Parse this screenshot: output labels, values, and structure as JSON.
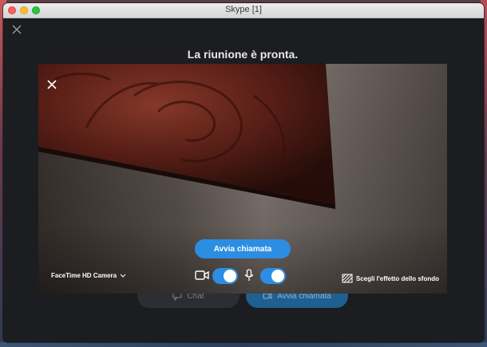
{
  "window": {
    "title": "Skype [1]"
  },
  "main": {
    "heading": "La riunione è pronta.",
    "chat_button": "Chat",
    "start_call_button": "Avvia chiamata"
  },
  "preview": {
    "start_call_label": "Avvia chiamata",
    "camera_name": "FaceTime HD Camera",
    "background_effect": "Scegli l'effetto dello sfondo",
    "video_enabled": true,
    "mic_enabled": true
  },
  "colors": {
    "accent": "#2b8ee3",
    "window_bg": "#1b1d20"
  },
  "icons": [
    "close-icon",
    "chevron-down-icon",
    "video-camera-icon",
    "microphone-icon",
    "background-effect-icon",
    "chat-icon",
    "call-icon"
  ]
}
